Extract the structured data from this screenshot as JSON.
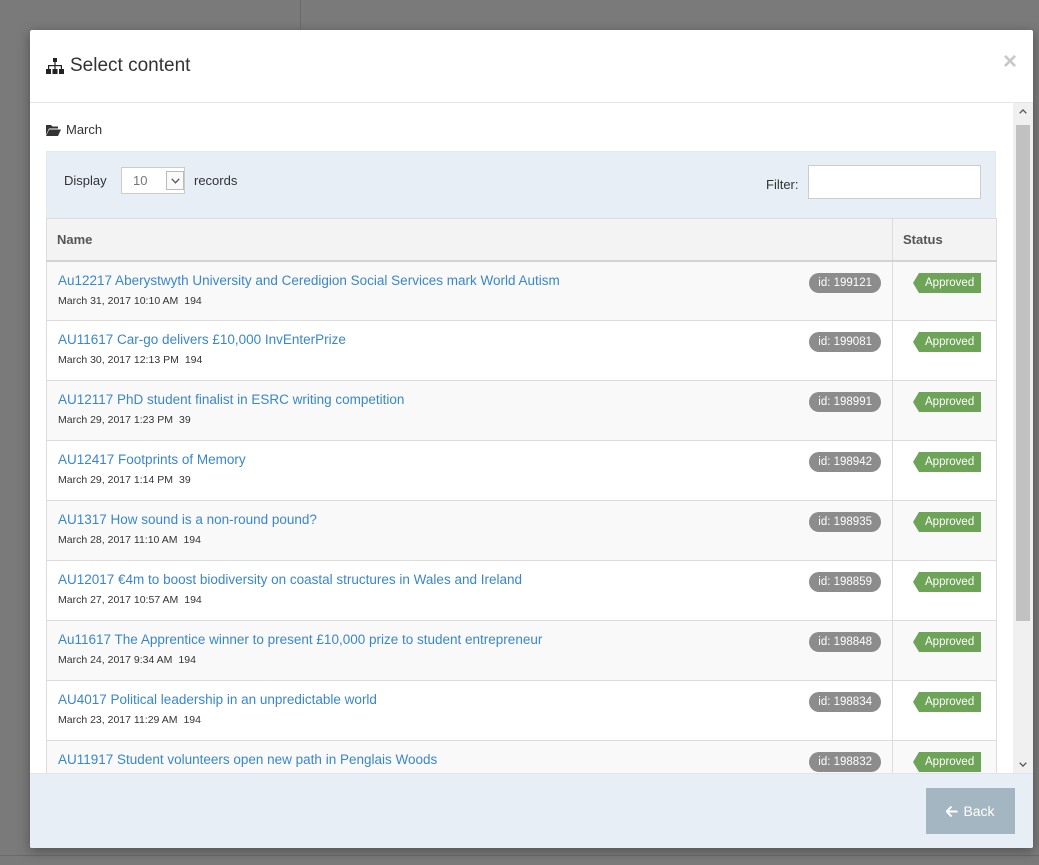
{
  "modal": {
    "title": "Select content",
    "close_glyph": "×"
  },
  "breadcrumb": {
    "folder": "March",
    "icon": "folder-open-icon"
  },
  "controls": {
    "display_label": "Display",
    "page_size": "10",
    "records_label": "records",
    "filter_label": "Filter:",
    "filter_value": ""
  },
  "table": {
    "headers": {
      "name": "Name",
      "status": "Status"
    },
    "rows": [
      {
        "title": "Au12217 Aberystwyth University and Ceredigion Social Services mark World Autism",
        "date": "March 31, 2017 10:10 AM",
        "views": "194",
        "id": "id: 199121",
        "status": "Approved"
      },
      {
        "title": "AU11617 Car-go delivers £10,000 InvEnterPrize",
        "date": "March 30, 2017 12:13 PM",
        "views": "194",
        "id": "id: 199081",
        "status": "Approved"
      },
      {
        "title": "AU12117 PhD student finalist in ESRC writing competition",
        "date": "March 29, 2017 1:23 PM",
        "views": "39",
        "id": "id: 198991",
        "status": "Approved"
      },
      {
        "title": "AU12417 Footprints of Memory",
        "date": "March 29, 2017 1:14 PM",
        "views": "39",
        "id": "id: 198942",
        "status": "Approved"
      },
      {
        "title": "AU1317 How sound is a non-round pound?",
        "date": "March 28, 2017 11:10 AM",
        "views": "194",
        "id": "id: 198935",
        "status": "Approved"
      },
      {
        "title": "AU12017 €4m to boost biodiversity on coastal structures in Wales and Ireland",
        "date": "March 27, 2017 10:57 AM",
        "views": "194",
        "id": "id: 198859",
        "status": "Approved"
      },
      {
        "title": "Au11617 The Apprentice winner to present £10,000 prize to student entrepreneur",
        "date": "March 24, 2017 9:34 AM",
        "views": "194",
        "id": "id: 198848",
        "status": "Approved"
      },
      {
        "title": "AU4017 Political leadership in an unpredictable world",
        "date": "March 23, 2017 11:29 AM",
        "views": "194",
        "id": "id: 198834",
        "status": "Approved"
      },
      {
        "title": "AU11917 Student volunteers open new path in Penglais Woods",
        "date": "",
        "views": "",
        "id": "id: 198832",
        "status": "Approved"
      }
    ]
  },
  "footer": {
    "back_label": "Back"
  },
  "colors": {
    "link": "#3a87c8",
    "status_approved": "#6ea458",
    "id_badge": "#8c8c8c",
    "panel_bg": "#e8eef5",
    "back_button": "#a5b6c3"
  }
}
